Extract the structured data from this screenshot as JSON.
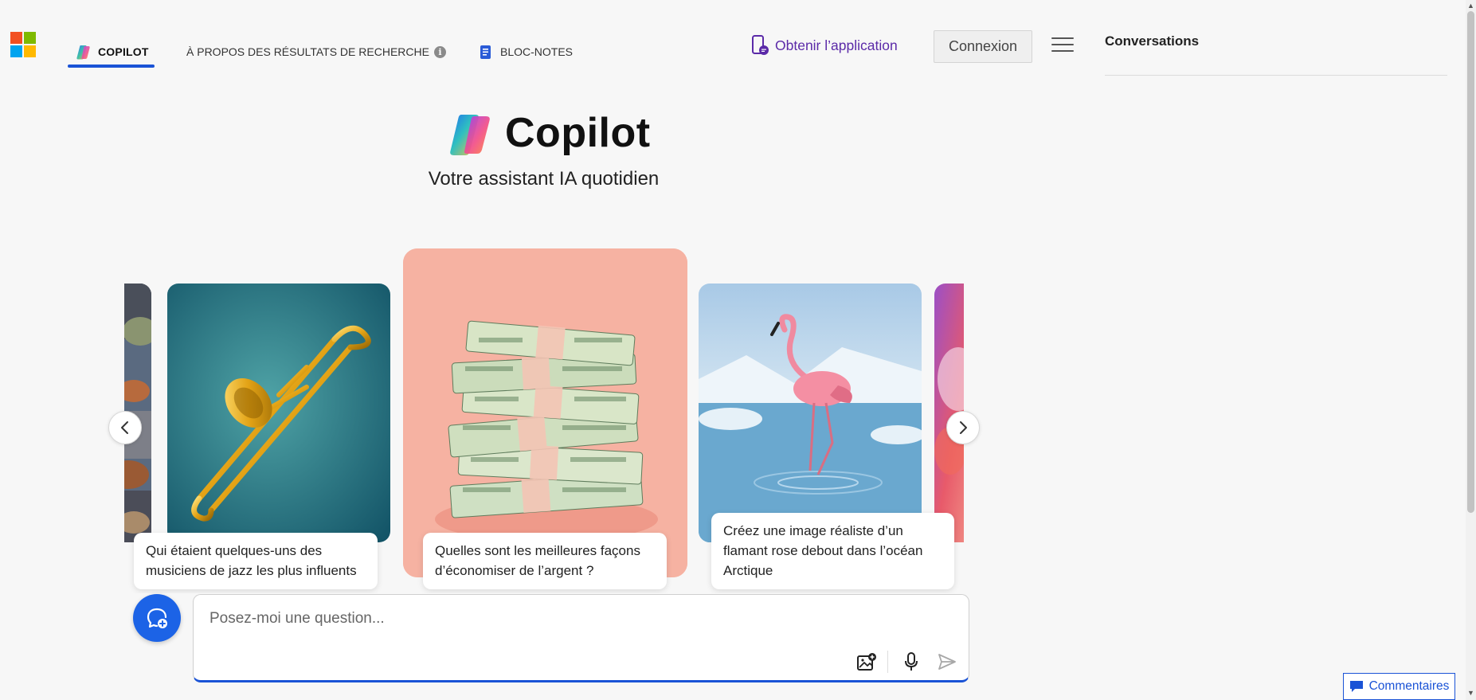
{
  "header": {
    "tabs": [
      {
        "label": "COPILOT",
        "active": true
      },
      {
        "label": "À PROPOS DES RÉSULTATS DE RECHERCHE",
        "info": "i"
      },
      {
        "label": "BLOC-NOTES"
      }
    ],
    "get_app_label": "Obtenir l’application",
    "login_label": "Connexion"
  },
  "sidebar": {
    "title": "Conversations"
  },
  "hero": {
    "title": "Copilot",
    "subtitle": "Votre assistant IA quotidien"
  },
  "carousel": {
    "cards": [
      {
        "caption": "",
        "image": "clothing-image",
        "visibility": "partial"
      },
      {
        "caption": "Qui étaient quelques-uns des musiciens de jazz les plus influents",
        "image": "trombone-image"
      },
      {
        "caption": "Quelles sont les meilleures façons d’économiser de l’argent ?",
        "image": "money-stack-image",
        "active": true
      },
      {
        "caption": "Créez une image réaliste d’un flamant rose debout dans l’océan Arctique",
        "image": "flamingo-image"
      },
      {
        "caption": "",
        "image": "abstract-paint-image",
        "visibility": "partial"
      }
    ]
  },
  "composer": {
    "placeholder": "Posez-moi une question...",
    "tools": [
      "add-image-icon",
      "microphone-icon",
      "send-icon"
    ]
  },
  "feedback": {
    "label": "Commentaires"
  },
  "colors": {
    "accent": "#1a53d6",
    "app_link": "#5b2aa8",
    "background": "#f7f7f7"
  }
}
